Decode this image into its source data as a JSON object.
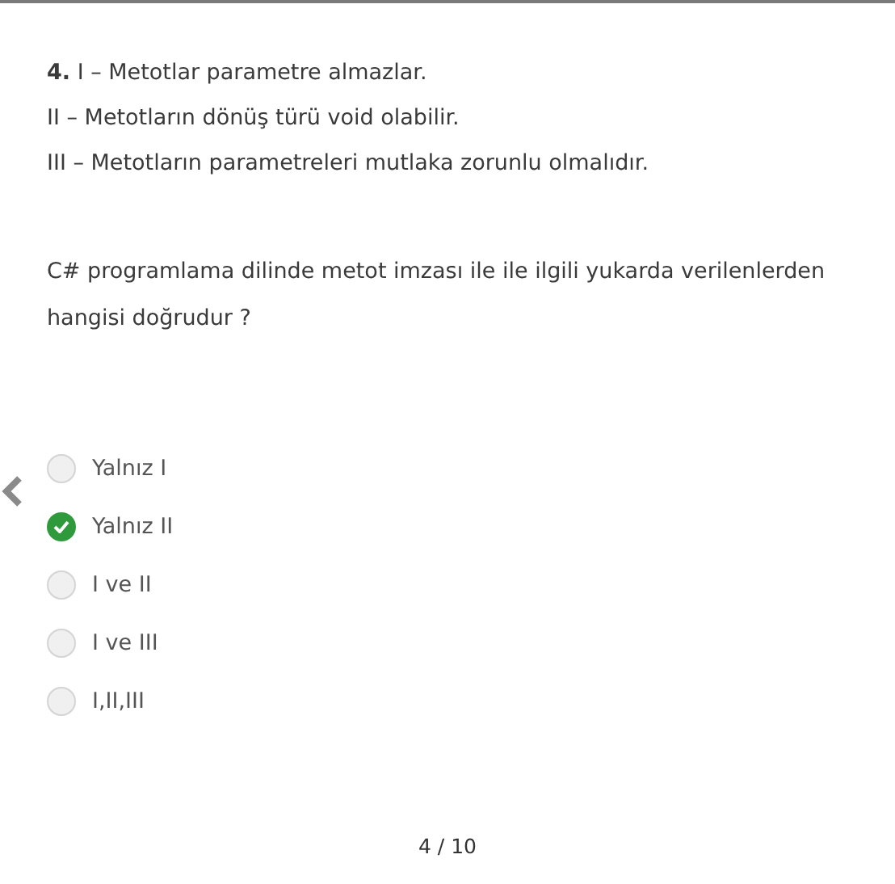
{
  "question": {
    "number": "4.",
    "statements": [
      "I – Metotlar parametre almazlar.",
      "II – Metotların dönüş türü void olabilir.",
      "III – Metotların parametreleri mutlaka zorunlu olmalıdır."
    ],
    "prompt": "C# programlama dilinde metot imzası ile ile ilgili yukarda verilenlerden hangisi doğrudur ?"
  },
  "options": [
    {
      "label": "Yalnız I",
      "selected": false
    },
    {
      "label": "Yalnız II",
      "selected": true
    },
    {
      "label": "I ve II",
      "selected": false
    },
    {
      "label": "I ve III",
      "selected": false
    },
    {
      "label": "I,II,III",
      "selected": false
    }
  ],
  "pager": "4 / 10"
}
